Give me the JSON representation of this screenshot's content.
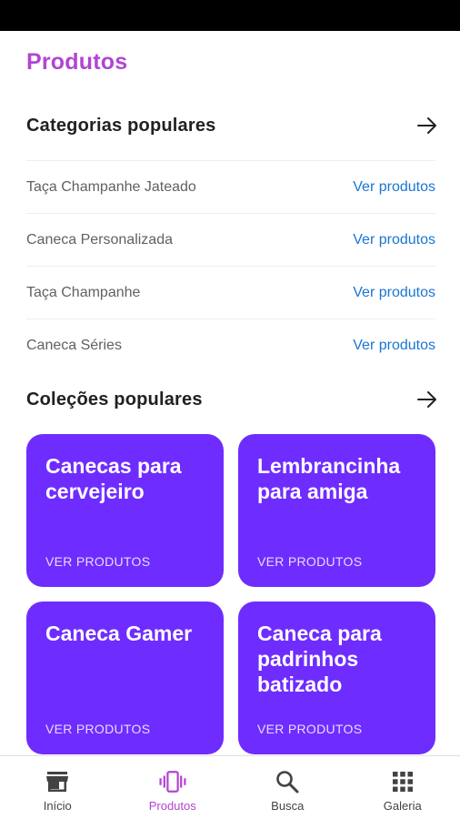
{
  "header": {
    "title": "Produtos"
  },
  "popular_categories": {
    "title": "Categorias populares",
    "items": [
      {
        "name": "Taça Champanhe Jateado",
        "link": "Ver produtos"
      },
      {
        "name": "Caneca Personalizada",
        "link": "Ver produtos"
      },
      {
        "name": "Taça Champanhe",
        "link": "Ver produtos"
      },
      {
        "name": "Caneca Séries",
        "link": "Ver produtos"
      }
    ]
  },
  "popular_collections": {
    "title": "Coleções populares",
    "items": [
      {
        "title": "Canecas para cervejeiro",
        "cta": "VER PRODUTOS"
      },
      {
        "title": "Lembrancinha para amiga",
        "cta": "VER PRODUTOS"
      },
      {
        "title": "Caneca Gamer",
        "cta": "VER PRODUTOS"
      },
      {
        "title": "Caneca para padrinhos batizado",
        "cta": "VER PRODUTOS"
      }
    ]
  },
  "bottom_nav": {
    "items": [
      {
        "label": "Início",
        "icon": "store-icon"
      },
      {
        "label": "Produtos",
        "icon": "vibration-phone-icon",
        "active": true
      },
      {
        "label": "Busca",
        "icon": "search-icon"
      },
      {
        "label": "Galeria",
        "icon": "grid-icon"
      }
    ]
  },
  "colors": {
    "accent": "#b245d1",
    "card": "#6f2cff",
    "link": "#1976d2"
  }
}
